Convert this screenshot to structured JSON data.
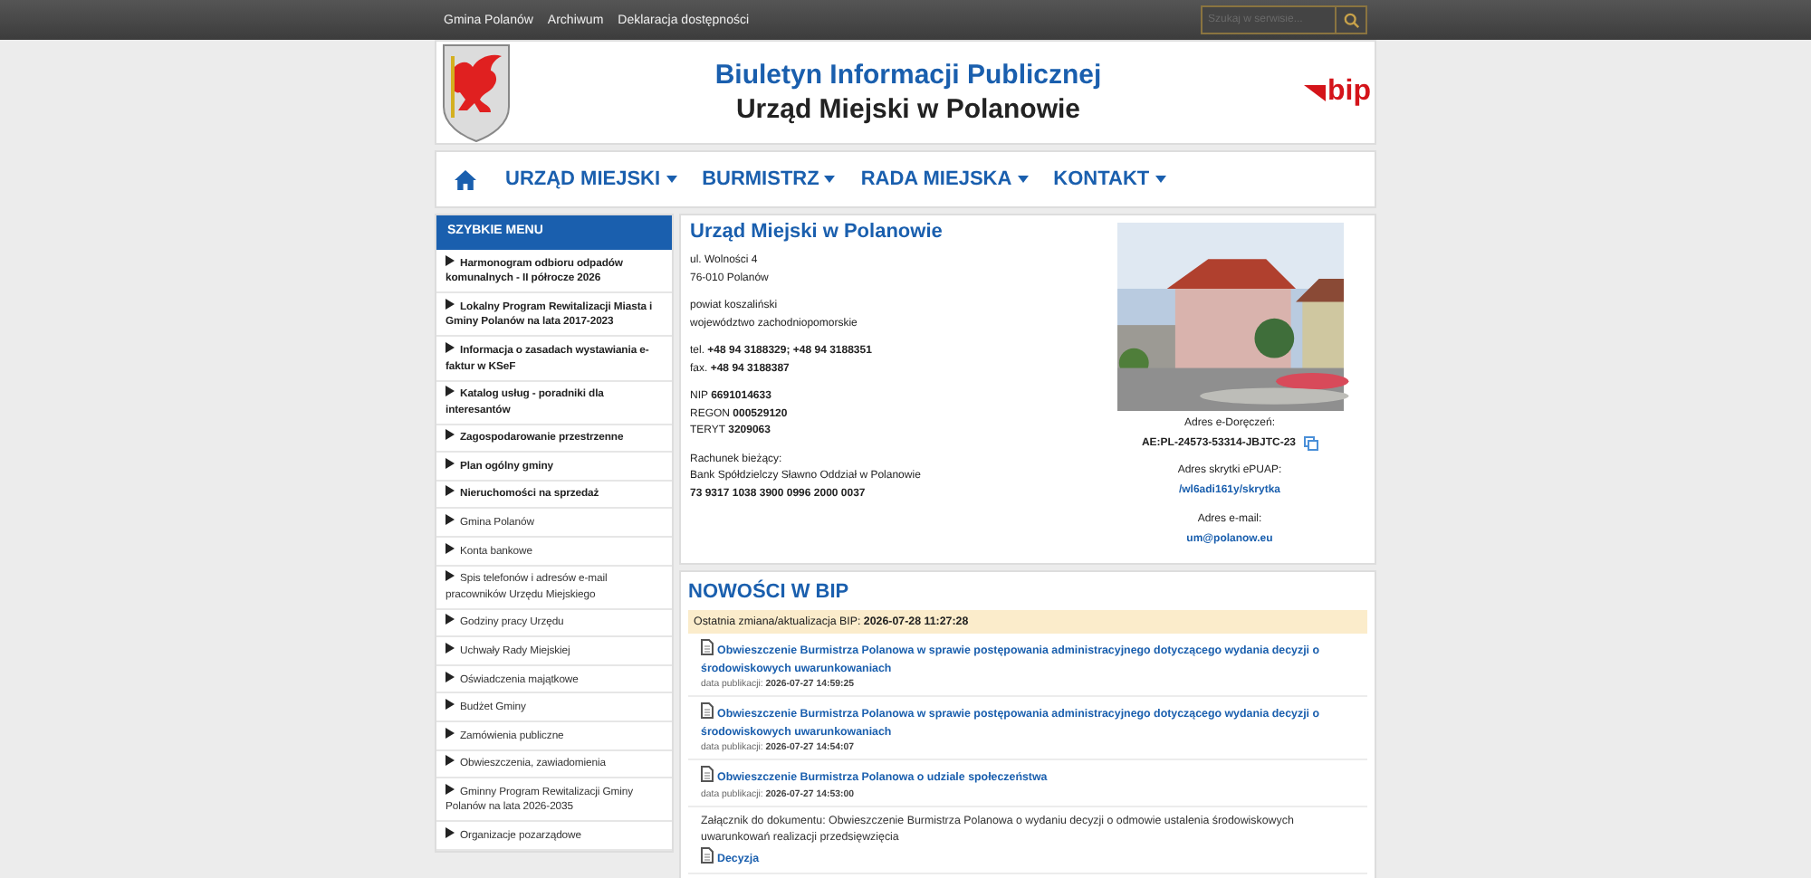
{
  "top_bar": {
    "links": [
      "Gmina Polanów",
      "Archiwum",
      "Deklaracja dostępności"
    ],
    "search": {
      "placeholder": "Szukaj w serwisie..."
    }
  },
  "header": {
    "title": "Biuletyn Informacji Publicznej",
    "subtitle": "Urząd Miejski w Polanowie",
    "bip_logo": "bip"
  },
  "nav": {
    "items": [
      {
        "label": "URZĄD MIEJSKI"
      },
      {
        "label": "BURMISTRZ"
      },
      {
        "label": "RADA MIEJSKA"
      },
      {
        "label": "KONTAKT"
      }
    ]
  },
  "sidebar": {
    "title": "SZYBKIE MENU",
    "items": [
      {
        "label": "Harmonogram odbioru odpadów komunalnych - II półrocze 2026",
        "emphasized": true
      },
      {
        "label": "Lokalny Program Rewitalizacji Miasta i Gminy Polanów na lata 2017-2023",
        "emphasized": true
      },
      {
        "label": "Informacja o zasadach wystawiania e-faktur w KSeF",
        "emphasized": true
      },
      {
        "label": "Katalog usług - poradniki dla interesantów",
        "emphasized": true
      },
      {
        "label": "Zagospodarowanie przestrzenne",
        "emphasized": true
      },
      {
        "label": "Plan ogólny gminy",
        "emphasized": true
      },
      {
        "label": "Nieruchomości na sprzedaż",
        "emphasized": true
      },
      {
        "label": "Gmina Polanów",
        "emphasized": false
      },
      {
        "label": "Konta bankowe",
        "emphasized": false
      },
      {
        "label": "Spis telefonów i adresów e-mail pracowników Urzędu Miejskiego",
        "emphasized": false
      },
      {
        "label": "Godziny pracy Urzędu",
        "emphasized": false
      },
      {
        "label": "Uchwały Rady Miejskiej",
        "emphasized": false
      },
      {
        "label": "Oświadczenia majątkowe",
        "emphasized": false
      },
      {
        "label": "Budżet Gminy",
        "emphasized": false
      },
      {
        "label": "Zamówienia publiczne",
        "emphasized": false
      },
      {
        "label": "Obwieszczenia, zawiadomienia",
        "emphasized": false
      },
      {
        "label": "Gminny Program Rewitalizacji Gminy Polanów na lata 2026-2035",
        "emphasized": false
      },
      {
        "label": "Organizacje pozarządowe",
        "emphasized": false
      }
    ]
  },
  "contact": {
    "title": "Urząd Miejski w Polanowie",
    "blocks": [
      [
        "ul. Wolności 4",
        "76-010 Polanów"
      ],
      [
        "powiat koszaliński",
        "województwo zachodniopomorskie"
      ],
      [
        "tel. **+48 94 3188329; +48 94 3188351**",
        "fax. **+48 94 3188387**"
      ],
      [
        "NIP **6691014633**",
        "REGON **000529120**",
        "TERYT **3209063**"
      ],
      [
        "Rachunek bieżący:",
        "Bank Spółdzielczy Sławno Oddział w Polanowie",
        "**73 9317 1038 3900 0996 2000 0037**"
      ]
    ],
    "photo": {
      "kind": "picture"
    },
    "e_delivery_label": "Adres e-Doręczeń:",
    "e_delivery": "AE:PL-24573-53314-JBJTC-23",
    "epuap_label": "Adres skrytki ePUAP:",
    "epuap_link": "/wl6adi161y/skrytka",
    "email_label": "Adres e-mail:",
    "email_link": "um@polanow.eu"
  },
  "news": {
    "title": "NOWOŚCI W BIP",
    "last_update": "Ostatnia zmiana/aktualizacja BIP: **2026-07-28 11:27:28**",
    "items": [
      {
        "kind": "document",
        "title": "Obwieszczenie Burmistrza Polanowa w sprawie postępowania administracyjnego dotyczącego wydania decyzji o środowiskowych uwarunkowaniach",
        "date": "data publikacji: **2026-07-27 14:59:25**"
      },
      {
        "kind": "document",
        "title": "Obwieszczenie Burmistrza Polanowa w sprawie postępowania administracyjnego dotyczącego wydania decyzji o środowiskowych uwarunkowaniach",
        "date": "data publikacji: **2026-07-27 14:54:07**"
      },
      {
        "kind": "document",
        "title": "Obwieszczenie Burmistrza Polanowa o udziale społeczeństwa",
        "date": "data publikacji: **2026-07-27 14:53:00**"
      },
      {
        "kind": "attachment",
        "text": "Załącznik do dokumentu: Obwieszczenie Burmistrza Polanowa o wydaniu decyzji o odmowie ustalenia środowiskowych uwarunkowań realizacji przedsięwzięcia",
        "title": "Decyzja"
      }
    ]
  }
}
